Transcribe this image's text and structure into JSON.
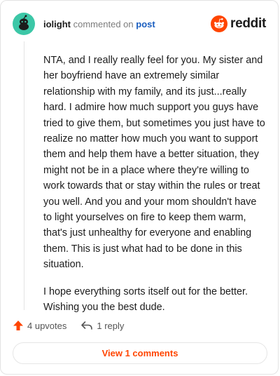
{
  "comment": {
    "username": "iolight",
    "verb": "commented on",
    "post_link": "post",
    "brand": "reddit",
    "paragraphs": [
      "NTA, and I really really feel for you. My sister and her boyfriend have an extremely similar relationship with my family, and its just...really hard. I admire how much support you guys have tried to give them, but sometimes you just have to realize no matter how much you want to support them and help them have a better situation, they might not be in a place where they're willing to work towards that or stay within the rules or treat you well. And you and your mom shouldn't have to light yourselves on fire to keep them warm, that's just unhealthy for everyone and enabling them. This is just what had to be done in this situation.",
      "I hope everything sorts itself out for the better. Wishing you the best dude."
    ],
    "upvotes": "4 upvotes",
    "replies": "1 reply",
    "view_comments": "View 1 comments"
  },
  "colors": {
    "accent": "#ff4500",
    "avatar": "#3cc7a7",
    "link": "#1a5ec0"
  },
  "icons": [
    "avatar-snoo-icon",
    "reddit-logo-icon",
    "upvote-arrow-icon",
    "reply-arrow-icon"
  ]
}
